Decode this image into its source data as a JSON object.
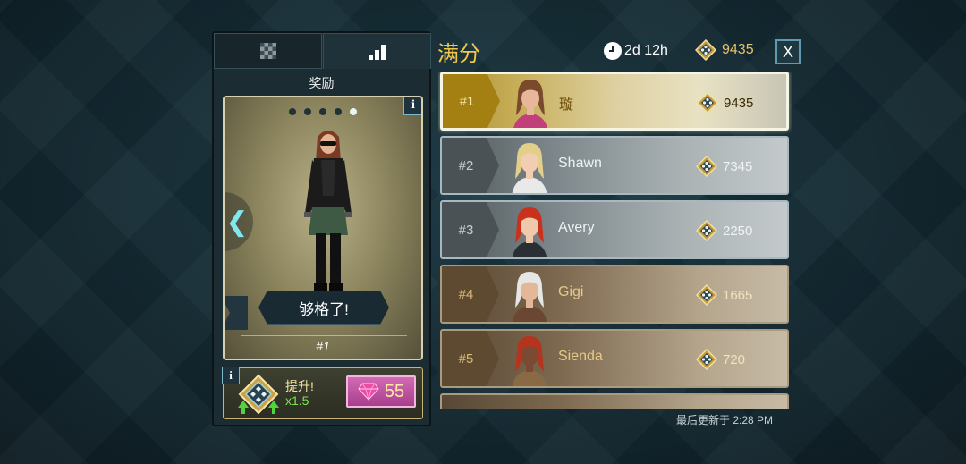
{
  "tabs": [
    {
      "icon": "checker-grid-icon",
      "active": false
    },
    {
      "icon": "bar-chart-icon",
      "active": true
    }
  ],
  "reward": {
    "title": "奖励",
    "dots_count": 5,
    "active_dot": 4,
    "banner": "够格了!",
    "rank": "#1",
    "info_label": "i"
  },
  "boost": {
    "info_label": "i",
    "label": "提升!",
    "multiplier": "x1.5",
    "gem_amount": "55"
  },
  "header": {
    "title": "满分",
    "timer": "2d 12h",
    "score": "9435",
    "close_label": "X"
  },
  "leaderboard": [
    {
      "rank": "#1",
      "name": "璇",
      "score": "9435",
      "tier": "first",
      "hair": "#7a4a2c",
      "skin": "#e8b69a",
      "shirt": "#c2407a"
    },
    {
      "rank": "#2",
      "name": "Shawn",
      "score": "7345",
      "tier": "silver",
      "hair": "#e3cf8a",
      "skin": "#f1cdb3",
      "shirt": "#e9e9e9"
    },
    {
      "rank": "#3",
      "name": "Avery",
      "score": "2250",
      "tier": "silver",
      "hair": "#c8321c",
      "skin": "#f0c9ad",
      "shirt": "#2a2f36"
    },
    {
      "rank": "#4",
      "name": "Gigi",
      "score": "1665",
      "tier": "bronze",
      "hair": "#e6e6e6",
      "skin": "#e3b797",
      "shirt": "#6b4632"
    },
    {
      "rank": "#5",
      "name": "Sienda",
      "score": "720",
      "tier": "bronze",
      "hair": "#b5341e",
      "skin": "#7a4a33",
      "shirt": "#8a6a45"
    }
  ],
  "last_updated": "最后更新于 2:28 PM",
  "colors": {
    "accent_gold": "#f1c84b",
    "cyan": "#7fe9f2",
    "gem_pink": "#d36ab4",
    "boost_green": "#7ee34f"
  }
}
